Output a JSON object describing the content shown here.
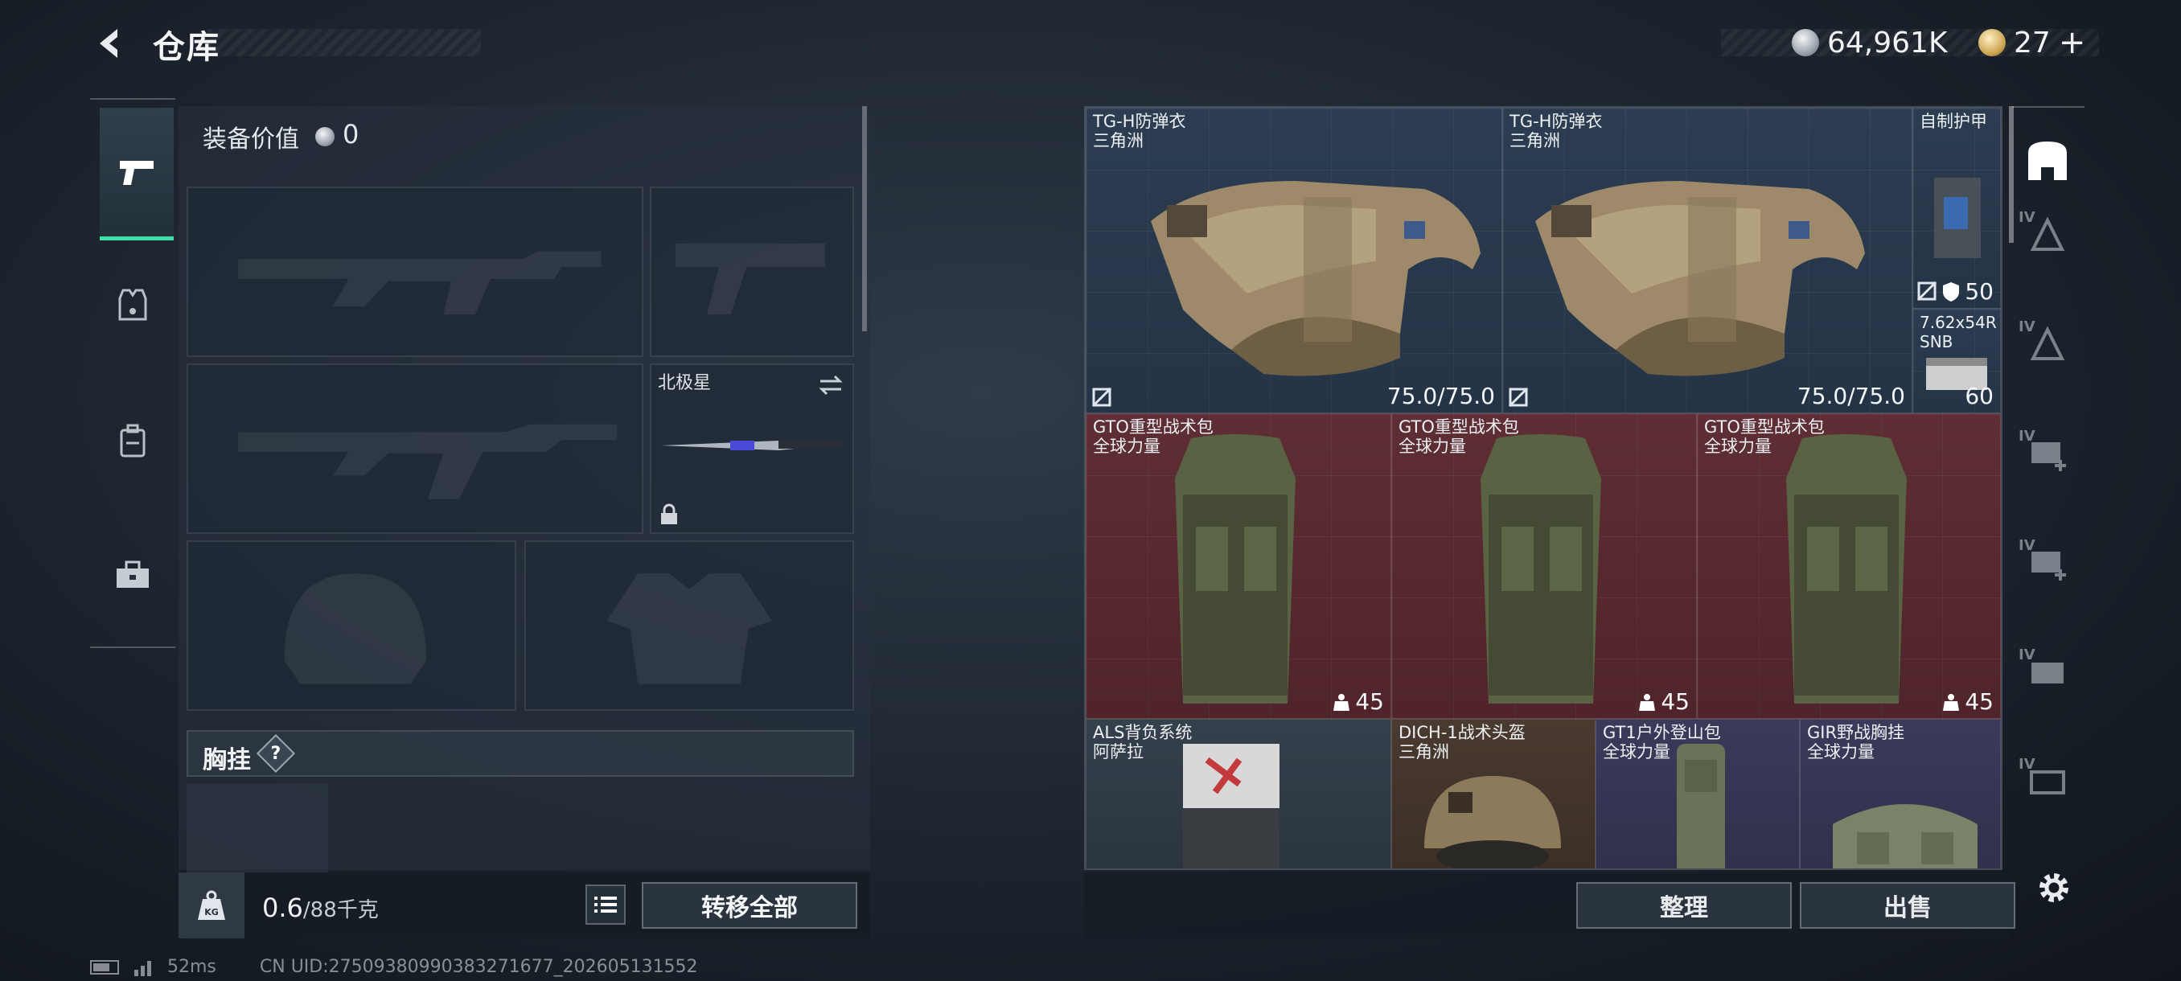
{
  "header": {
    "title": "仓库",
    "currency_silver": "64,961K",
    "currency_gold": "27",
    "currency_gold_add": "+"
  },
  "left_panel": {
    "equip_value_label": "装备价值",
    "equip_value": "0",
    "melee_slot_label": "北极星",
    "chest_rig_label": "胸挂",
    "chest_rig_help": "?",
    "weight_current": "0.6",
    "weight_max": "/88千克",
    "transfer_all": "转移全部"
  },
  "stash": {
    "items": [
      {
        "name": "TG-H防弹衣",
        "sub": "三角洲",
        "durability": "75.0/75.0",
        "rarity": "blue"
      },
      {
        "name": "TG-H防弹衣",
        "sub": "三角洲",
        "durability": "75.0/75.0",
        "rarity": "blue"
      },
      {
        "name": "自制护甲",
        "sub": "",
        "stat": "50",
        "rarity": "blue"
      },
      {
        "name": "7.62x54R",
        "sub": "SNB",
        "stat": "60",
        "rarity": "blue"
      },
      {
        "name": "GTO重型战术包",
        "sub": "全球力量",
        "stat": "45",
        "rarity": "red"
      },
      {
        "name": "GTO重型战术包",
        "sub": "全球力量",
        "stat": "45",
        "rarity": "red"
      },
      {
        "name": "GTO重型战术包",
        "sub": "全球力量",
        "stat": "45",
        "rarity": "red"
      },
      {
        "name": "ALS背负系统",
        "sub": "阿萨拉",
        "rarity": "dark"
      },
      {
        "name": "DICH-1战术头盔",
        "sub": "三角洲",
        "rarity": "brown"
      },
      {
        "name": "GT1户外登山包",
        "sub": "全球力量",
        "rarity": "purple"
      },
      {
        "name": "GIR野战胸挂",
        "sub": "全球力量",
        "rarity": "purple"
      }
    ],
    "sort_label": "整理",
    "sell_label": "出售"
  },
  "right_rail": {
    "tiers": [
      "IV",
      "IV",
      "IV",
      "IV",
      "IV",
      "IV"
    ]
  },
  "status": {
    "ping": "52ms",
    "uid": "CN UID:27509380990383271677_202605131552"
  },
  "colors": {
    "accent_green": "#3fe0a7",
    "rarity_red": "#5e2e34",
    "rarity_blue": "#2c3d52",
    "rarity_purple": "#3a3a5a",
    "rarity_brown": "#4a3a30"
  }
}
